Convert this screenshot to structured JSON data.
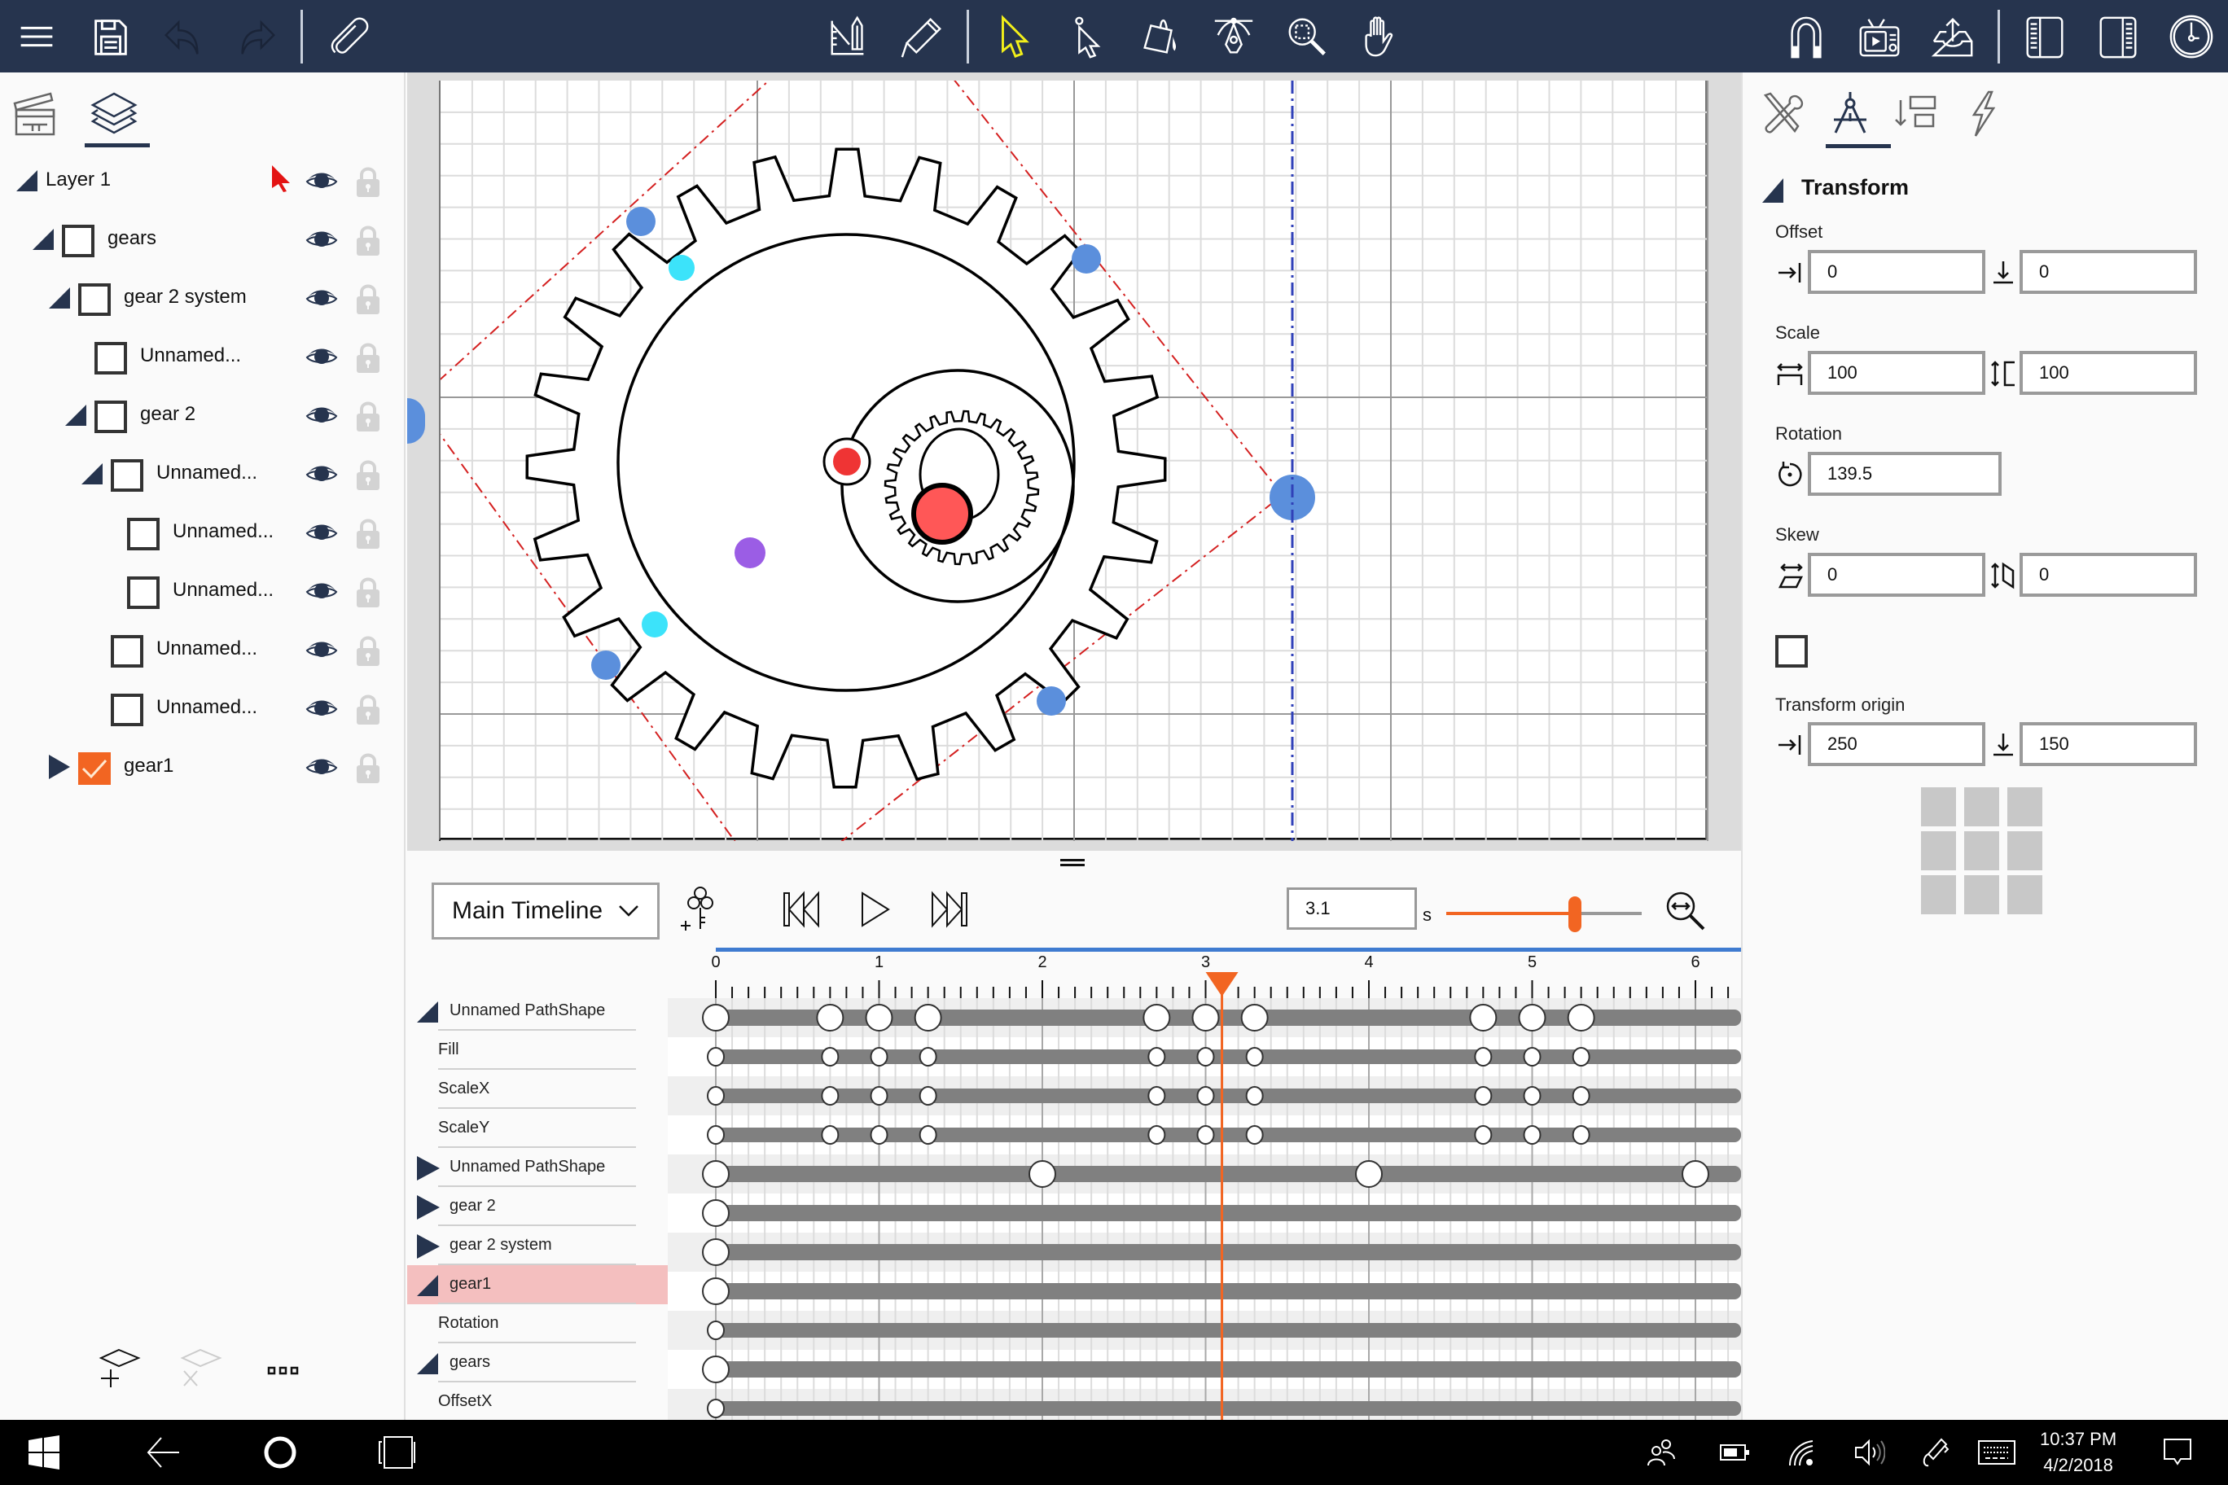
{
  "toolbar": {
    "left_icons": [
      "menu-icon",
      "save-icon",
      "undo-icon",
      "redo-icon",
      "attach-icon"
    ],
    "center_icons": [
      "shape-tools-icon",
      "pen-icon",
      "select-icon",
      "direct-select-icon",
      "fill-bucket-icon",
      "pen-nib-icon",
      "zoom-icon",
      "hand-icon"
    ],
    "active_tool": "select",
    "active_color": "#f2ef1a",
    "right_icons": [
      "snap-magnet-icon",
      "preview-icon",
      "export-icon",
      "left-panel-icon",
      "right-panel-icon",
      "timeline-clock-icon"
    ]
  },
  "left_panel": {
    "tabs": [
      {
        "name": "timeline-tab",
        "icon": "clapperboard-icon",
        "active": false
      },
      {
        "name": "layers-tab",
        "icon": "layers-icon",
        "active": true
      }
    ],
    "layers": [
      {
        "label": "Layer 1",
        "level": 0,
        "expander": "expanded",
        "checkbox": false,
        "visible": true,
        "locked": false
      },
      {
        "label": "gears",
        "level": 1,
        "expander": "expanded",
        "checkbox": "unchecked",
        "visible": true,
        "locked": false
      },
      {
        "label": "gear 2 system",
        "level": 2,
        "expander": "expanded",
        "checkbox": "unchecked",
        "visible": true,
        "locked": false
      },
      {
        "label": "Unnamed...",
        "level": 3,
        "expander": "none",
        "checkbox": "unchecked",
        "visible": true,
        "locked": false
      },
      {
        "label": "gear 2",
        "level": 3,
        "expander": "expanded",
        "checkbox": "unchecked",
        "visible": true,
        "locked": false
      },
      {
        "label": "Unnamed...",
        "level": 4,
        "expander": "expanded",
        "checkbox": "unchecked",
        "visible": true,
        "locked": false
      },
      {
        "label": "Unnamed...",
        "level": 5,
        "expander": "none",
        "checkbox": "unchecked",
        "visible": true,
        "locked": false
      },
      {
        "label": "Unnamed...",
        "level": 5,
        "expander": "none",
        "checkbox": "unchecked",
        "visible": true,
        "locked": false
      },
      {
        "label": "Unnamed...",
        "level": 4,
        "expander": "none",
        "checkbox": "unchecked",
        "visible": true,
        "locked": false
      },
      {
        "label": "Unnamed...",
        "level": 4,
        "expander": "none",
        "checkbox": "unchecked",
        "visible": true,
        "locked": false
      },
      {
        "label": "gear1",
        "level": 2,
        "expander": "collapsed",
        "checkbox": "checked",
        "visible": true,
        "locked": false
      }
    ],
    "footer_buttons": [
      "add-layer-button",
      "delete-layer-button",
      "more-options-button"
    ],
    "accent": "#f26522"
  },
  "right_panel": {
    "tabs": [
      "tools-tab",
      "transform-tab",
      "align-tab",
      "effects-tab"
    ],
    "active_tab": "transform-tab",
    "section_title": "Transform",
    "offset": {
      "label": "Offset",
      "x": "0",
      "y": "0"
    },
    "scale": {
      "label": "Scale",
      "x": "100",
      "y": "100"
    },
    "rotation": {
      "label": "Rotation",
      "value": "139.5"
    },
    "skew": {
      "label": "Skew",
      "x": "0",
      "y": "0"
    },
    "uniform_checkbox": false,
    "transform_origin": {
      "label": "Transform origin",
      "x": "250",
      "y": "150"
    }
  },
  "timeline": {
    "selector": "Main Timeline",
    "time_value": "3.1",
    "time_unit": "s",
    "zoom_slider_fraction": 0.66,
    "ruler_labels": [
      "0",
      "1",
      "2",
      "3",
      "4",
      "5",
      "6"
    ],
    "playhead_time": 3.1,
    "visible_range_seconds": [
      0,
      6.28
    ],
    "tracks": [
      {
        "label": "Unnamed PathShape",
        "type": "group",
        "expander": "expanded",
        "keyframes": [
          0,
          0.7,
          1.0,
          1.3,
          2.7,
          3.0,
          3.3,
          4.7,
          5.0,
          5.3
        ]
      },
      {
        "label": "Fill",
        "type": "property",
        "keyframes": [
          0,
          0.7,
          1.0,
          1.3,
          2.7,
          3.0,
          3.3,
          4.7,
          5.0,
          5.3
        ]
      },
      {
        "label": "ScaleX",
        "type": "property",
        "keyframes": [
          0,
          0.7,
          1.0,
          1.3,
          2.7,
          3.0,
          3.3,
          4.7,
          5.0,
          5.3
        ]
      },
      {
        "label": "ScaleY",
        "type": "property",
        "keyframes": [
          0,
          0.7,
          1.0,
          1.3,
          2.7,
          3.0,
          3.3,
          4.7,
          5.0,
          5.3
        ]
      },
      {
        "label": "Unnamed PathShape",
        "type": "group",
        "expander": "collapsed",
        "keyframes": [
          0,
          2.0,
          4.0,
          6.0
        ]
      },
      {
        "label": "gear 2",
        "type": "group",
        "expander": "collapsed",
        "keyframes": [
          0
        ]
      },
      {
        "label": "gear 2 system",
        "type": "group",
        "expander": "collapsed",
        "keyframes": [
          0
        ]
      },
      {
        "label": "gear1",
        "type": "group",
        "expander": "expanded",
        "selected": true,
        "keyframes": [
          0
        ]
      },
      {
        "label": "Rotation",
        "type": "property",
        "keyframes": [
          0
        ]
      },
      {
        "label": "gears",
        "type": "group",
        "expander": "expanded",
        "keyframes": [
          0
        ]
      },
      {
        "label": "OffsetX",
        "type": "property",
        "keyframes": [
          0
        ]
      }
    ],
    "colors": {
      "playhead": "#f26522",
      "range_bar": "#3f7bd0",
      "track_bar": "#808080",
      "selected_row": "#f4bfbf"
    }
  },
  "taskbar": {
    "left_icons": [
      "windows-start-icon",
      "back-icon",
      "cortana-icon",
      "task-view-icon"
    ],
    "tray_icons": [
      "people-icon",
      "battery-icon",
      "wifi-icon",
      "volume-icon",
      "pen-workspace-icon",
      "keyboard-icon"
    ],
    "time": "10:37 PM",
    "date": "4/2/2018",
    "notification_icon": "action-center-icon"
  }
}
